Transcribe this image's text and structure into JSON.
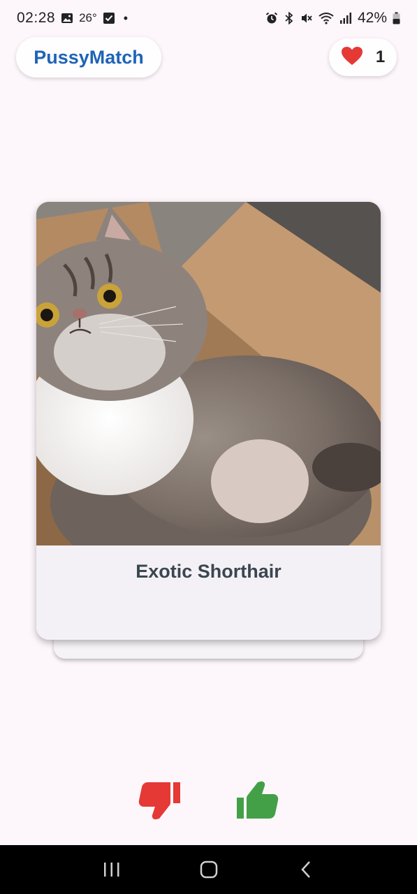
{
  "status_bar": {
    "time": "02:28",
    "temperature": "26°",
    "battery": "42%",
    "icons": [
      "image-icon",
      "check-box-icon",
      "alarm-icon",
      "bluetooth-icon",
      "mute-icon",
      "wifi-icon",
      "signal-icon",
      "battery-icon"
    ]
  },
  "header": {
    "app_name": "PussyMatch",
    "likes_count": "1",
    "heart_icon": "heart-icon",
    "brand_color": "#1e63b8",
    "heart_color": "#e53935"
  },
  "card": {
    "breed": "Exotic Shorthair",
    "photo": "cat-photo"
  },
  "actions": {
    "dislike_icon": "thumbs-down-icon",
    "like_icon": "thumbs-up-icon",
    "dislike_color": "#e53935",
    "like_color": "#43a047"
  },
  "nav": {
    "icons": [
      "recent-apps-icon",
      "home-icon",
      "back-icon"
    ]
  }
}
